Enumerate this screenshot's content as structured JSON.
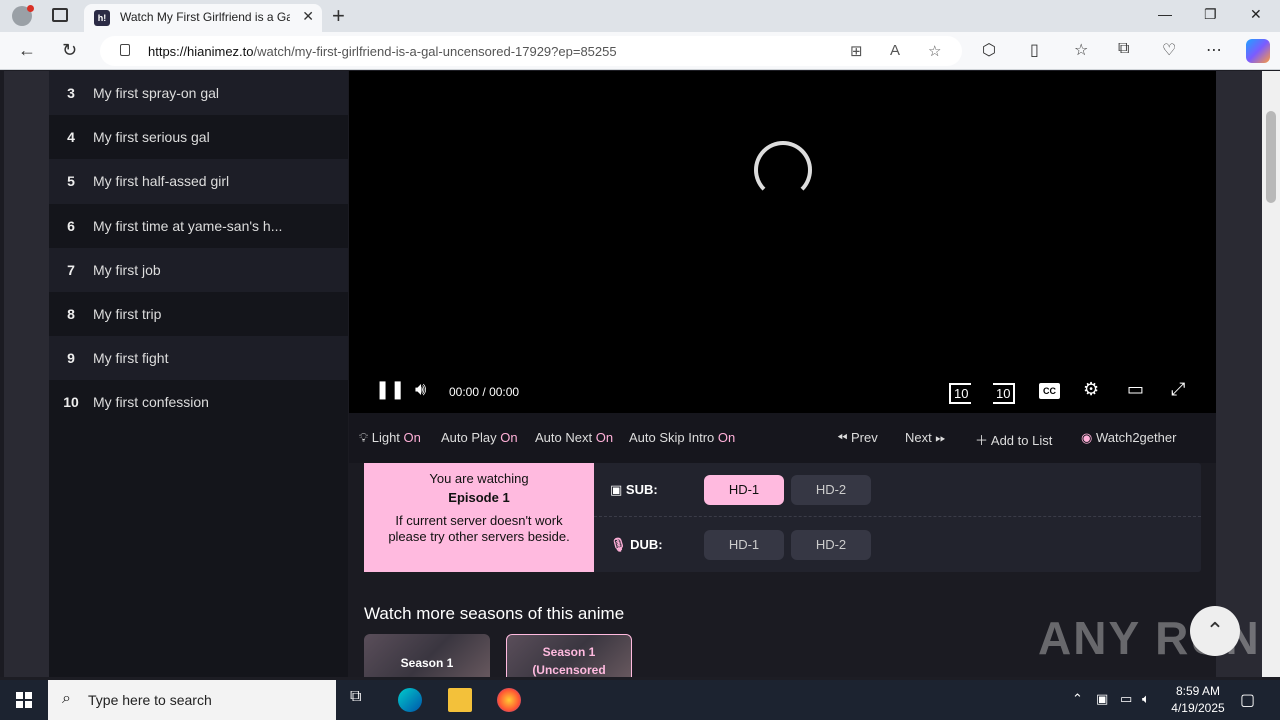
{
  "browser": {
    "tab_title": "Watch My First Girlfriend is a Gal",
    "favicon_text": "h!",
    "url_host": "https://hianimez.to",
    "url_path": "/watch/my-first-girlfriend-is-a-gal-uncensored-17929?ep=85255",
    "new_tab": "+",
    "close": "✕",
    "minimize": "—",
    "restore": "❐",
    "close_window": "✕"
  },
  "episodes": [
    {
      "num": "3",
      "title": "My first spray-on gal"
    },
    {
      "num": "4",
      "title": "My first serious gal"
    },
    {
      "num": "5",
      "title": "My first half-assed girl"
    },
    {
      "num": "6",
      "title": "My first time at yame-san's h..."
    },
    {
      "num": "7",
      "title": "My first job"
    },
    {
      "num": "8",
      "title": "My first trip"
    },
    {
      "num": "9",
      "title": "My first fight"
    },
    {
      "num": "10",
      "title": "My first confession"
    }
  ],
  "player": {
    "current_time": "00:00",
    "separator": "/",
    "duration": "00:00",
    "rewind_label": "10",
    "forward_label": "10",
    "cc_label": "CC"
  },
  "options": {
    "light": "Light",
    "light_state": "On",
    "autoplay": "Auto Play",
    "autoplay_state": "On",
    "autonext": "Auto Next",
    "autonext_state": "On",
    "autoskip": "Auto Skip Intro",
    "autoskip_state": "On",
    "prev": "Prev",
    "next": "Next",
    "add_to_list": "Add to List",
    "watch2gether": "Watch2gether"
  },
  "servers": {
    "notice_line1": "You are watching",
    "notice_episode": "Episode 1",
    "notice_line2": "If current server doesn't work please try other servers beside.",
    "sub_label": "SUB:",
    "dub_label": "DUB:",
    "sub_servers": [
      "HD-1",
      "HD-2"
    ],
    "dub_servers": [
      "HD-1",
      "HD-2"
    ],
    "accent": "#ffbadf"
  },
  "seasons": {
    "title": "Watch more seasons of this anime",
    "cards": [
      {
        "label": "Season 1"
      },
      {
        "label": "Season 1",
        "sub": "(Uncensored"
      }
    ]
  },
  "watermark": "ANY RUN",
  "taskbar": {
    "search_placeholder": "Type here to search",
    "time": "8:59 AM",
    "date": "4/19/2025"
  }
}
